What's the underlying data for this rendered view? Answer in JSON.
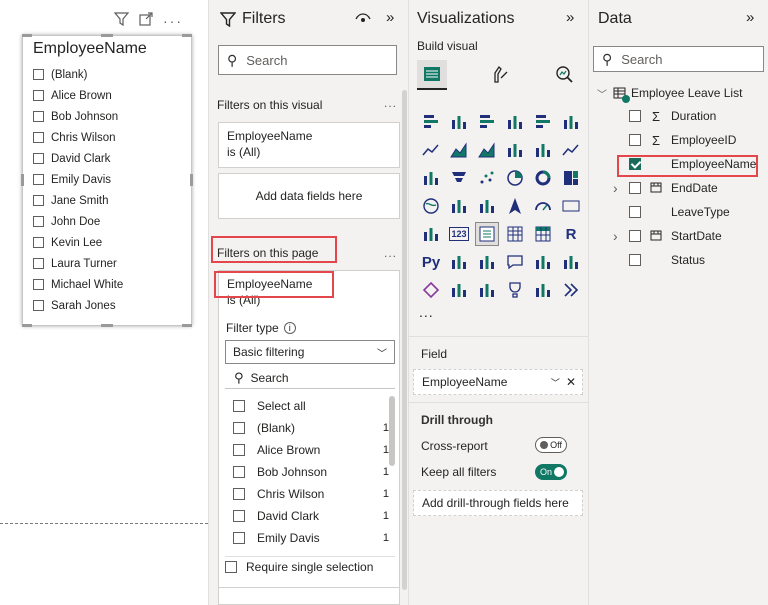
{
  "slicer": {
    "header_icons": [
      "filter-icon",
      "focus-mode-icon",
      "more-options-icon"
    ],
    "title": "EmployeeName",
    "items": [
      "(Blank)",
      "Alice Brown",
      "Bob Johnson",
      "Chris Wilson",
      "David Clark",
      "Emily Davis",
      "Jane Smith",
      "John Doe",
      "Kevin Lee",
      "Laura Turner",
      "Michael White",
      "Sarah Jones"
    ]
  },
  "filters": {
    "title": "Filters",
    "search_placeholder": "Search",
    "on_visual_label": "Filters on this visual",
    "visual_card": {
      "field": "EmployeeName",
      "state": "is (All)"
    },
    "add_fields": "Add data fields here",
    "on_page_label": "Filters on this page",
    "page_card": {
      "field": "EmployeeName",
      "state": "is (All)"
    },
    "filter_type_label": "Filter type",
    "filter_type_value": "Basic filtering",
    "inner_search": "Search",
    "rows": [
      {
        "label": "Select all",
        "count": ""
      },
      {
        "label": "(Blank)",
        "count": "1"
      },
      {
        "label": "Alice Brown",
        "count": "1"
      },
      {
        "label": "Bob Johnson",
        "count": "1"
      },
      {
        "label": "Chris Wilson",
        "count": "1"
      },
      {
        "label": "David Clark",
        "count": "1"
      },
      {
        "label": "Emily Davis",
        "count": "1"
      }
    ],
    "require_single": "Require single selection"
  },
  "viz": {
    "title": "Visualizations",
    "build_visual": "Build visual",
    "more": "...",
    "field_label": "Field",
    "field_value": "EmployeeName",
    "drill_through": "Drill through",
    "cross_report": "Cross-report",
    "cross_report_state": "Off",
    "keep_all_filters": "Keep all filters",
    "keep_all_state": "On",
    "add_drill": "Add drill-through fields here",
    "icon_text": {
      "r": "R",
      "py": "Py",
      "n123": "123"
    }
  },
  "data": {
    "title": "Data",
    "search_placeholder": "Search",
    "table": "Employee Leave List",
    "fields": [
      {
        "name": "Duration",
        "kind": "sigma",
        "checked": false,
        "expand": false
      },
      {
        "name": "EmployeeID",
        "kind": "sigma",
        "checked": false,
        "expand": false
      },
      {
        "name": "EmployeeName",
        "kind": "text",
        "checked": true,
        "expand": false
      },
      {
        "name": "EndDate",
        "kind": "date",
        "checked": false,
        "expand": true
      },
      {
        "name": "LeaveType",
        "kind": "text",
        "checked": false,
        "expand": false
      },
      {
        "name": "StartDate",
        "kind": "date",
        "checked": false,
        "expand": true
      },
      {
        "name": "Status",
        "kind": "text",
        "checked": false,
        "expand": false
      }
    ]
  },
  "colors": {
    "highlight": "#e3474b",
    "accent": "#117865",
    "pane": "#f3f2f1"
  }
}
